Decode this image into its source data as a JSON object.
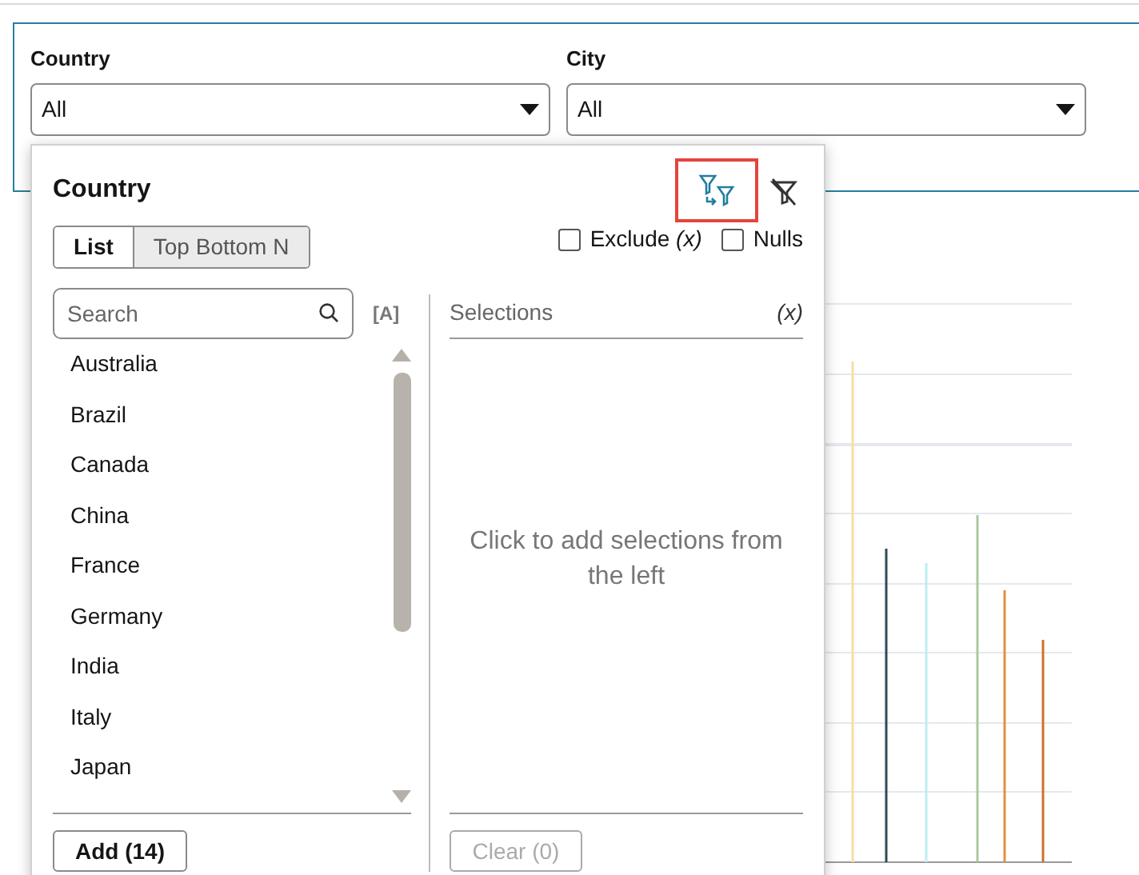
{
  "filters": [
    {
      "label": "Country",
      "value": "All"
    },
    {
      "label": "City",
      "value": "All"
    }
  ],
  "popup": {
    "title": "Country",
    "tabs": [
      {
        "label": "List",
        "selected": true
      },
      {
        "label": "Top Bottom N",
        "selected": false
      }
    ],
    "options": [
      {
        "label": "Exclude *(x)*",
        "checked": false
      },
      {
        "label": "Nulls",
        "checked": false
      }
    ],
    "search": {
      "placeholder": "Search"
    },
    "case_toggle": "[A]",
    "items": [
      "Australia",
      "Brazil",
      "Canada",
      "China",
      "France",
      "Germany",
      "India",
      "Italy",
      "Japan"
    ],
    "add_button": {
      "label": "Add (14)",
      "disabled": false
    },
    "selections": {
      "title": "Selections",
      "expression": "(x)",
      "empty_message": "Click to add selections from the left"
    },
    "clear_button": {
      "label": "Clear (0)",
      "disabled": true
    }
  }
}
